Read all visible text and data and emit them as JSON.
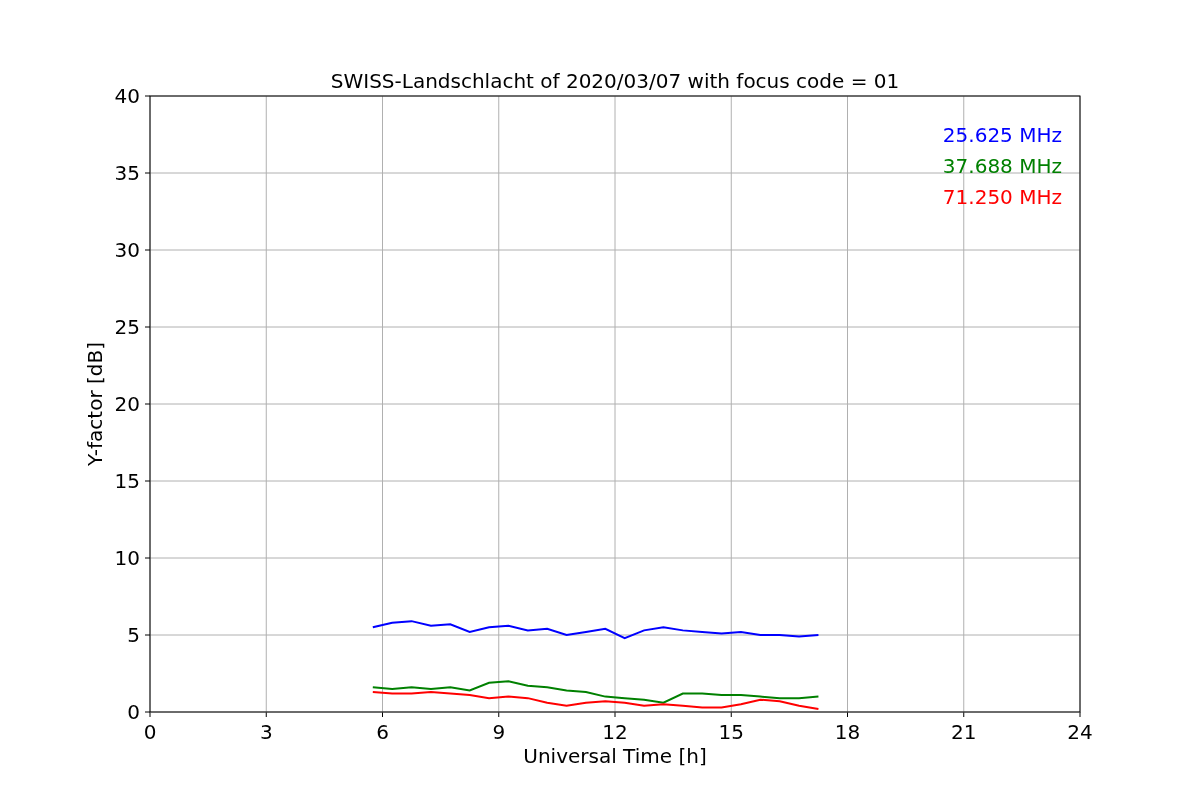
{
  "figure": {
    "chart_data": {
      "type": "line",
      "title": "SWISS-Landschlacht of 2020/03/07 with focus code = 01",
      "xlabel": "Universal Time [h]",
      "ylabel": "Y-factor [dB]",
      "x": [
        5.75,
        6.25,
        6.75,
        7.25,
        7.75,
        8.25,
        8.75,
        9.25,
        9.75,
        10.25,
        10.75,
        11.25,
        11.75,
        12.25,
        12.75,
        13.25,
        13.75,
        14.25,
        14.75,
        15.25,
        15.75,
        16.25,
        16.75,
        17.25
      ],
      "series": [
        {
          "name": "25.625 MHz",
          "color": "#0000ff",
          "values": [
            5.5,
            5.8,
            5.9,
            5.6,
            5.7,
            5.2,
            5.5,
            5.6,
            5.3,
            5.4,
            5.0,
            5.2,
            5.4,
            4.8,
            5.3,
            5.5,
            5.3,
            5.2,
            5.1,
            5.2,
            5.0,
            5.0,
            4.9,
            5.0
          ]
        },
        {
          "name": "37.688 MHz",
          "color": "#008000",
          "values": [
            1.6,
            1.5,
            1.6,
            1.5,
            1.6,
            1.4,
            1.9,
            2.0,
            1.7,
            1.6,
            1.4,
            1.3,
            1.0,
            0.9,
            0.8,
            0.6,
            1.2,
            1.2,
            1.1,
            1.1,
            1.0,
            0.9,
            0.9,
            1.0
          ]
        },
        {
          "name": "71.250 MHz",
          "color": "#ff0000",
          "values": [
            1.3,
            1.2,
            1.2,
            1.3,
            1.2,
            1.1,
            0.9,
            1.0,
            0.9,
            0.6,
            0.4,
            0.6,
            0.7,
            0.6,
            0.4,
            0.5,
            0.4,
            0.3,
            0.3,
            0.5,
            0.8,
            0.7,
            0.4,
            0.2
          ]
        }
      ],
      "xlim": [
        0,
        24
      ],
      "ylim": [
        0,
        40
      ],
      "xticks": [
        0,
        3,
        6,
        9,
        12,
        15,
        18,
        21,
        24
      ],
      "yticks": [
        0,
        5,
        10,
        15,
        20,
        25,
        30,
        35,
        40
      ],
      "grid": true
    }
  }
}
